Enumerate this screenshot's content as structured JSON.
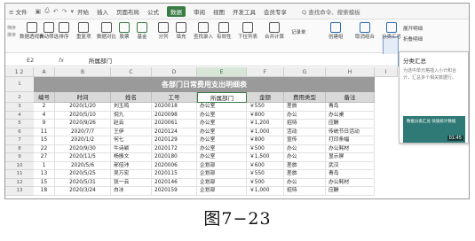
{
  "menu": {
    "file": "≡ 文件",
    "items": [
      "开始",
      "插入",
      "页面布局",
      "公式",
      "数据",
      "审阅",
      "视图",
      "开发工具",
      "会员专享"
    ],
    "active": "数据",
    "search": "Q 查找命令、搜索模板"
  },
  "ribbon": {
    "side": [
      "筛序",
      "排序",
      "重复项"
    ],
    "buttons": [
      "数据透视表",
      "自动筛选",
      "排序",
      "重复项",
      "数据对比",
      "股票",
      "基金",
      "分列",
      "填充",
      "查找录入",
      "有效性",
      "下拉列表",
      "合并计算",
      "记录单",
      "创建组",
      "取消组合",
      "分类汇总",
      "展开明细",
      "折叠明细"
    ]
  },
  "tooltip": {
    "title": "分类汇总",
    "desc": "为选中单元格插入小计和合计，汇总多个相关数据行。",
    "video_title": "数据分类汇总 快速统计数据",
    "duration": "01:45"
  },
  "formula_bar": {
    "name_box": "E2",
    "fx": "fx",
    "value": "所属部门"
  },
  "columns": [
    "A",
    "B",
    "C",
    "D",
    "E",
    "F",
    "G",
    "H",
    "I"
  ],
  "sheet": {
    "title": "各部门日常费用支出明细表",
    "headers": [
      "编号",
      "时间",
      "姓名",
      "工号",
      "所属部门",
      "金额",
      "费用类型",
      "备注"
    ],
    "row_numbers": [
      "1",
      "2",
      "3",
      "4",
      "5",
      "6",
      "7",
      "8",
      "9",
      "10",
      "11",
      "12",
      "13"
    ],
    "rows": [
      [
        "2",
        "2020/1/20",
        "刘玉鸣",
        "2020018",
        "办公室",
        "￥550",
        "差旅",
        "青岛"
      ],
      [
        "4",
        "2020/5/10",
        "倪九",
        "2020098",
        "办公室",
        "￥800",
        "办公",
        "办公桌"
      ],
      [
        "9",
        "2020/9/26",
        "赵云",
        "2020061",
        "办公室",
        "￥1,200",
        "招待",
        "应酬"
      ],
      [
        "11",
        "2020/7/7",
        "王伊",
        "2020124",
        "办公室",
        "￥1,000",
        "活动",
        "传统节日活动"
      ],
      [
        "15",
        "2020/1/2",
        "何七",
        "2020129",
        "办公室",
        "￥800",
        "宣传",
        "打印条幅"
      ],
      [
        "22",
        "2020/9/30",
        "牛诗颖",
        "2020172",
        "办公室",
        "￥500",
        "办公",
        "办公耗材"
      ],
      [
        "27",
        "2020/11/5",
        "杨振文",
        "2020180",
        "办公室",
        "￥1,500",
        "办公",
        "显示屏"
      ],
      [
        "1",
        "2020/5/6",
        "郝倍沛",
        "2020006",
        "企划部",
        "￥600",
        "差旅",
        "武汉"
      ],
      [
        "13",
        "2020/5/25",
        "吴万宏",
        "2020115",
        "企划部",
        "￥550",
        "差旅",
        "青岛"
      ],
      [
        "15",
        "2020/5/31",
        "张一云",
        "2020146",
        "企划部",
        "￥500",
        "办公",
        "办公耗材"
      ],
      [
        "18",
        "2020/3/24",
        "白冰",
        "2020159",
        "企划部",
        "￥1,000",
        "招待",
        "应酬"
      ]
    ]
  }
}
